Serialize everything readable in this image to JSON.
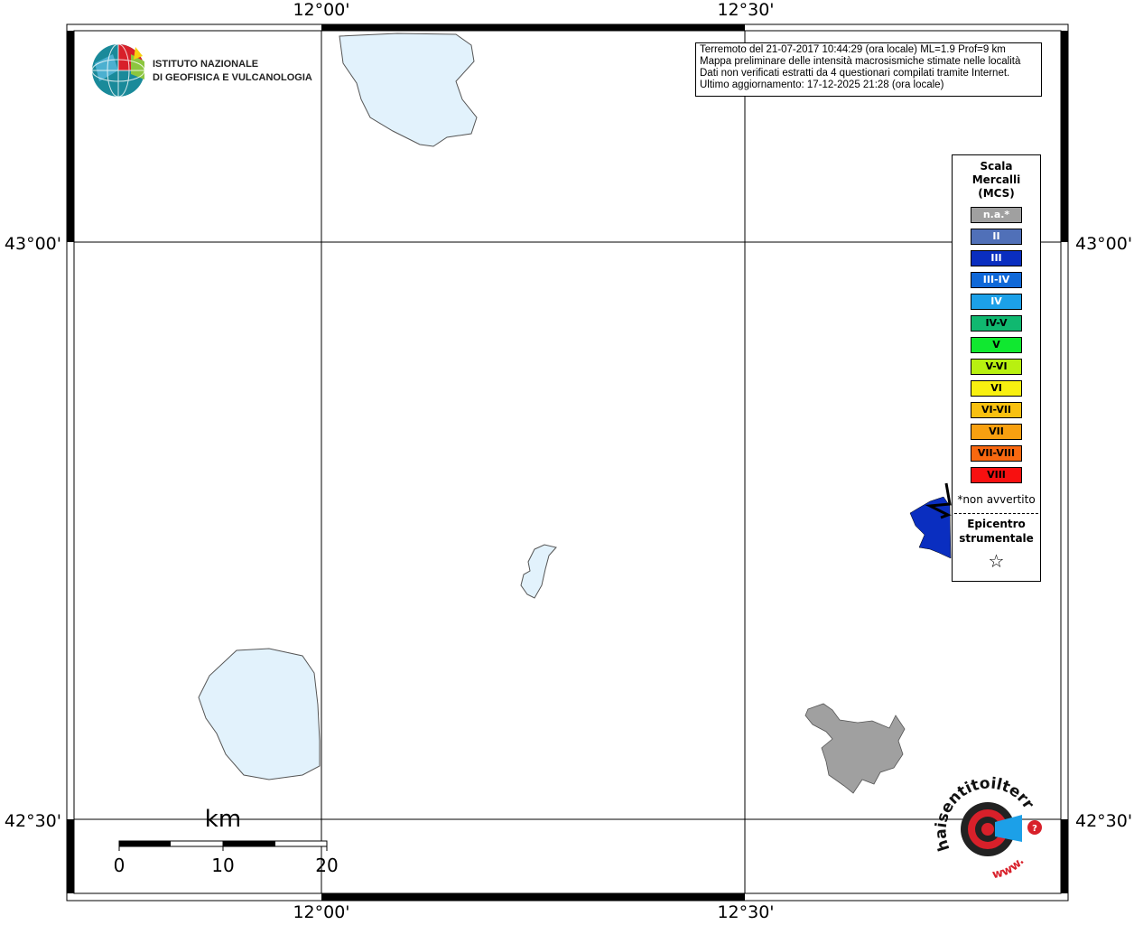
{
  "map": {
    "lon_labels": [
      "12°00'",
      "12°30'"
    ],
    "lat_labels": [
      "43°00'",
      "42°30'"
    ],
    "scale": {
      "unit": "km",
      "ticks": [
        "0",
        "10",
        "20"
      ]
    }
  },
  "logo": {
    "line1": "ISTITUTO NAZIONALE",
    "line2": "DI GEOFISICA E VULCANOLOGIA"
  },
  "info": {
    "lines": [
      "Terremoto del 21-07-2017 10:44:29 (ora locale) ML=1.9 Prof=9 km",
      "Mappa preliminare delle intensità macrosismiche stimate nelle località",
      "Dati non verificati estratti da 4 questionari compilati tramite Internet.",
      "Ultimo aggiornamento: 17-12-2025 21:28 (ora locale)"
    ]
  },
  "legend": {
    "title": [
      "Scala",
      "Mercalli",
      "(MCS)"
    ],
    "items": [
      {
        "label": "n.a.*",
        "color": "#a0a0a0",
        "text": "#ffffff"
      },
      {
        "label": "II",
        "color": "#5070b8",
        "text": "#ffffff"
      },
      {
        "label": "III",
        "color": "#0a2ec0",
        "text": "#ffffff"
      },
      {
        "label": "III-IV",
        "color": "#1068d8",
        "text": "#ffffff"
      },
      {
        "label": "IV",
        "color": "#1ca0e8",
        "text": "#ffffff"
      },
      {
        "label": "IV-V",
        "color": "#10b870",
        "text": "#000000"
      },
      {
        "label": "V",
        "color": "#10e830",
        "text": "#000000"
      },
      {
        "label": "V-VI",
        "color": "#b8f010",
        "text": "#000000"
      },
      {
        "label": "VI",
        "color": "#f8f010",
        "text": "#000000"
      },
      {
        "label": "VI-VII",
        "color": "#f8c010",
        "text": "#000000"
      },
      {
        "label": "VII",
        "color": "#f8a010",
        "text": "#000000"
      },
      {
        "label": "VII-VIII",
        "color": "#f86810",
        "text": "#000000"
      },
      {
        "label": "VIII",
        "color": "#f81010",
        "text": "#000000"
      }
    ],
    "note": "*non avvertito",
    "epicenter": [
      "Epicentro",
      "strumentale"
    ],
    "star": "☆"
  },
  "hsit_logo": {
    "text": "haisentitoilterremoto.it",
    "url": "www."
  },
  "colors": {
    "lake_fill": "#e2f2fc",
    "lake_stroke": "#555555",
    "area_gray": "#a0a0a0",
    "intensity_blue": "#0a2ec0"
  }
}
